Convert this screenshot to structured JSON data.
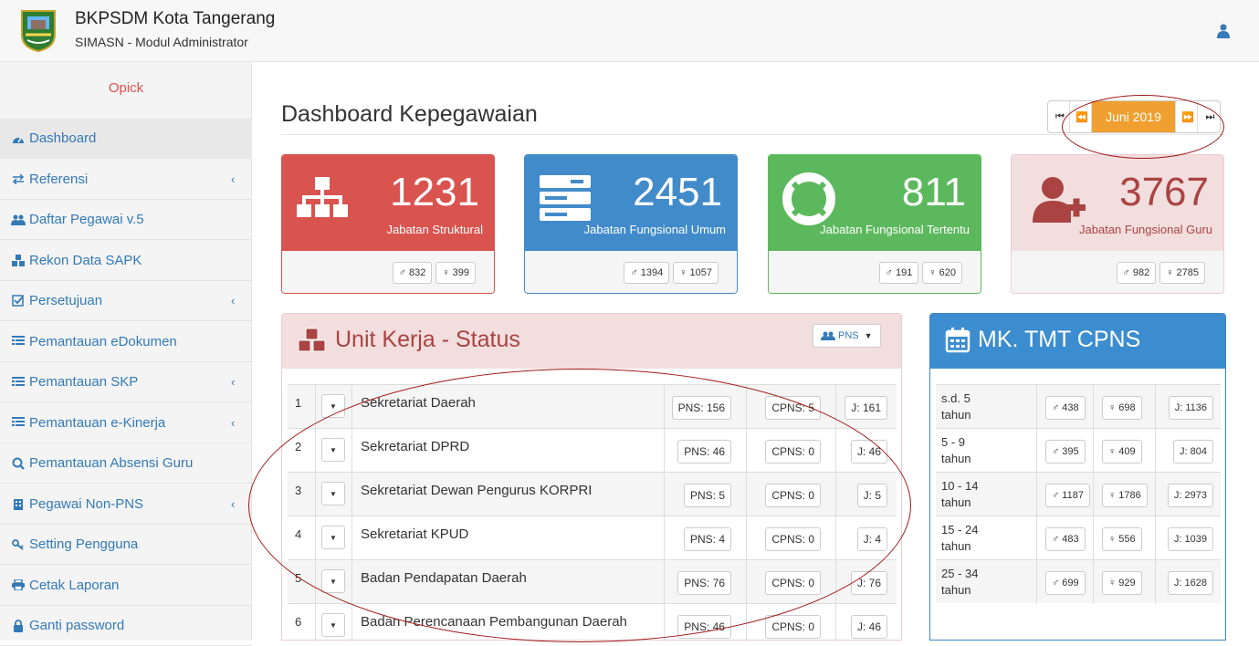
{
  "header": {
    "title": "BKPSDM Kota Tangerang",
    "subtitle": "SIMASN - Modul Administrator"
  },
  "sidebar": {
    "user": "Opick",
    "items": [
      {
        "label": "Dashboard",
        "icon": "dashboard-icon"
      },
      {
        "label": "Referensi",
        "icon": "exchange-icon",
        "has_children": true
      },
      {
        "label": "Daftar Pegawai v.5",
        "icon": "users-icon"
      },
      {
        "label": "Rekon Data SAPK",
        "icon": "cubes-icon"
      },
      {
        "label": "Persetujuan",
        "icon": "check-square-icon",
        "has_children": true
      },
      {
        "label": "Pemantauan eDokumen",
        "icon": "list-icon"
      },
      {
        "label": "Pemantauan SKP",
        "icon": "list-icon",
        "has_children": true
      },
      {
        "label": "Pemantauan e-Kinerja",
        "icon": "list-icon",
        "has_children": true
      },
      {
        "label": "Pemantauan Absensi Guru",
        "icon": "search-icon"
      },
      {
        "label": "Pegawai Non-PNS",
        "icon": "building-icon",
        "has_children": true
      },
      {
        "label": "Setting Pengguna",
        "icon": "key-icon"
      },
      {
        "label": "Cetak Laporan",
        "icon": "print-icon"
      },
      {
        "label": "Ganti password",
        "icon": "lock-icon"
      }
    ]
  },
  "main": {
    "title": "Dashboard Kepegawaian",
    "period": {
      "first": "⏮",
      "prev": "⏪",
      "month": "Juni 2019",
      "next": "⏩",
      "last": "⏭"
    },
    "stats": [
      {
        "value": "1231",
        "label": "Jabatan Struktural",
        "male": "♂ 832",
        "female": "♀ 399",
        "color": "#d9534f"
      },
      {
        "value": "2451",
        "label": "Jabatan Fungsional Umum",
        "male": "♂ 1394",
        "female": "♀ 1057",
        "color": "#428bca"
      },
      {
        "value": "811",
        "label": "Jabatan Fungsional Tertentu",
        "male": "♂ 191",
        "female": "♀ 620",
        "color": "#5cb85c"
      },
      {
        "value": "3767",
        "label": "Jabatan Fungsional Guru",
        "male": "♂ 982",
        "female": "♀ 2785",
        "color": "#f2dede"
      }
    ],
    "unit_panel": {
      "title": "Unit Kerja - Status",
      "filter": "PNS",
      "rows": [
        {
          "no": "1",
          "name": "Sekretariat Daerah",
          "pns": "PNS: 156",
          "cpns": "CPNS: 5",
          "total": "J: 161"
        },
        {
          "no": "2",
          "name": "Sekretariat DPRD",
          "pns": "PNS: 46",
          "cpns": "CPNS: 0",
          "total": "J: 46"
        },
        {
          "no": "3",
          "name": "Sekretariat Dewan Pengurus KORPRI",
          "pns": "PNS: 5",
          "cpns": "CPNS: 0",
          "total": "J: 5"
        },
        {
          "no": "4",
          "name": "Sekretariat KPUD",
          "pns": "PNS: 4",
          "cpns": "CPNS: 0",
          "total": "J: 4"
        },
        {
          "no": "5",
          "name": "Badan Pendapatan Daerah",
          "pns": "PNS: 76",
          "cpns": "CPNS: 0",
          "total": "J: 76"
        },
        {
          "no": "6",
          "name": "Badan Perencanaan Pembangunan Daerah",
          "pns": "PNS: 46",
          "cpns": "CPNS: 0",
          "total": "J: 46"
        }
      ]
    },
    "mk_panel": {
      "title": "MK. TMT CPNS",
      "rows": [
        {
          "label": "s.d. 5 tahun",
          "male": "♂ 438",
          "female": "♀ 698",
          "total": "J: 1136"
        },
        {
          "label": "5 - 9 tahun",
          "male": "♂ 395",
          "female": "♀ 409",
          "total": "J: 804"
        },
        {
          "label": "10 - 14 tahun",
          "male": "♂ 1187",
          "female": "♀ 1786",
          "total": "J: 2973"
        },
        {
          "label": "15 - 24 tahun",
          "male": "♂ 483",
          "female": "♀ 556",
          "total": "J: 1039"
        },
        {
          "label": "25 - 34 tahun",
          "male": "♂ 699",
          "female": "♀ 929",
          "total": "J: 1628"
        }
      ]
    }
  }
}
